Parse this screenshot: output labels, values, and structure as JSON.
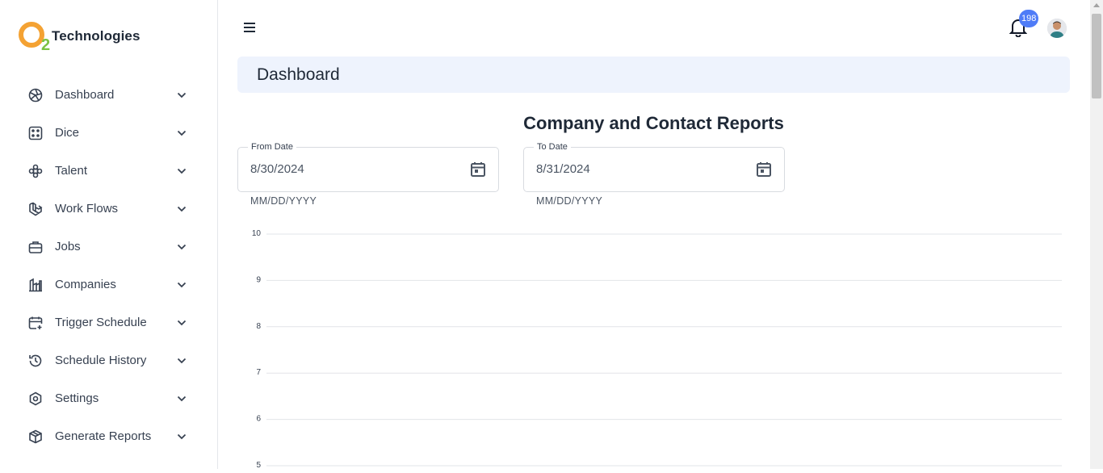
{
  "brand": {
    "name": "Technologies",
    "mark_text": "2"
  },
  "sidebar": {
    "items": [
      {
        "label": "Dashboard",
        "icon": "aperture-icon"
      },
      {
        "label": "Dice",
        "icon": "dice-icon"
      },
      {
        "label": "Talent",
        "icon": "puzzle-icon"
      },
      {
        "label": "Work Flows",
        "icon": "laravel-icon"
      },
      {
        "label": "Jobs",
        "icon": "briefcase-icon"
      },
      {
        "label": "Companies",
        "icon": "building-factory-icon"
      },
      {
        "label": "Trigger Schedule",
        "icon": "calendar-plus-icon"
      },
      {
        "label": "Schedule History",
        "icon": "history-icon"
      },
      {
        "label": "Settings",
        "icon": "hexagon-settings-icon"
      },
      {
        "label": "Generate Reports",
        "icon": "cube-icon"
      }
    ]
  },
  "topbar": {
    "notification_count": "198"
  },
  "header": {
    "title": "Dashboard"
  },
  "report": {
    "title": "Company and Contact Reports",
    "from_date": {
      "label": "From Date",
      "value": "8/30/2024",
      "hint": "MM/DD/YYYY"
    },
    "to_date": {
      "label": "To Date",
      "value": "8/31/2024",
      "hint": "MM/DD/YYYY"
    }
  },
  "chart_data": {
    "type": "bar",
    "categories": [],
    "series": [],
    "y_ticks": [
      "10",
      "9",
      "8",
      "7",
      "6",
      "5"
    ],
    "ylim": [
      5,
      10
    ],
    "grid": true
  },
  "colors": {
    "accent": "#4f7cf7",
    "header_bg": "#eef3fd",
    "logo_orange": "#f4a233",
    "logo_green": "#7cc243"
  }
}
